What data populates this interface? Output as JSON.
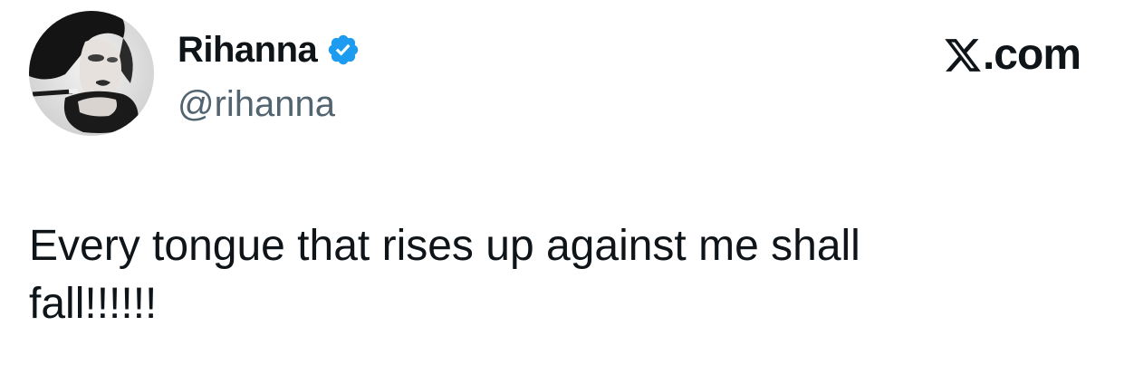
{
  "author": {
    "display_name": "Rihanna",
    "handle": "@rihanna",
    "verified": true,
    "verified_color": "#1d9bf0",
    "avatar_icon": "profile-photo"
  },
  "brand": {
    "logo_icon": "x-logo-icon",
    "suffix": ".com"
  },
  "tweet": {
    "text": "Every tongue that rises up against me shall\nfall!!!!!!"
  },
  "colors": {
    "text": "#0f1419",
    "secondary": "#536471",
    "background": "#ffffff"
  }
}
